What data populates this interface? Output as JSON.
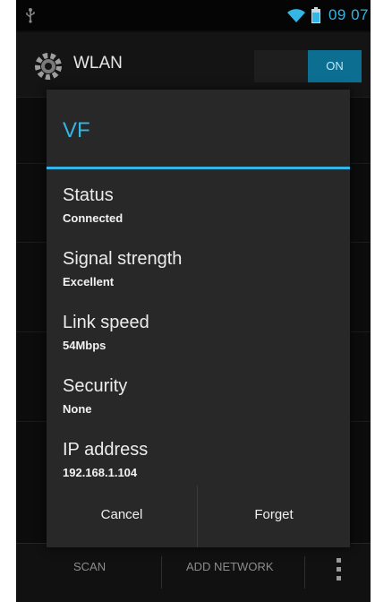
{
  "status_bar": {
    "time": "09 07",
    "icons": [
      "usb-icon",
      "wifi-icon",
      "battery-icon"
    ]
  },
  "action_bar": {
    "title": "WLAN",
    "icon": "settings-icon",
    "toggle_label": "ON"
  },
  "dialog": {
    "title": "VF",
    "items": [
      {
        "label": "Status",
        "value": "Connected"
      },
      {
        "label": "Signal strength",
        "value": "Excellent"
      },
      {
        "label": "Link speed",
        "value": "54Mbps"
      },
      {
        "label": "Security",
        "value": "None"
      },
      {
        "label": "IP address",
        "value": "192.168.1.104"
      }
    ],
    "cancel_label": "Cancel",
    "forget_label": "Forget"
  },
  "bottom_bar": {
    "scan_label": "SCAN",
    "add_network_label": "ADD NETWORK",
    "overflow_icon": "overflow-menu-icon"
  },
  "colors": {
    "accent": "#33b5e5",
    "background": "#0c0c0c",
    "dialog": "#282828"
  }
}
